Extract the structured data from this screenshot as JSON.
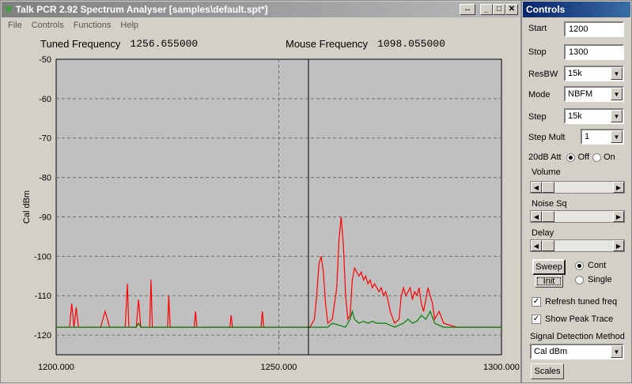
{
  "main_window": {
    "title": "Talk PCR 2.92 Spectrum Analyser [samples\\default.spt*]",
    "buttons": {
      "resize": "↔",
      "minimize": "_",
      "maximize": "□",
      "close": "✕"
    },
    "menu": [
      "File",
      "Controls",
      "Functions",
      "Help"
    ]
  },
  "readout": {
    "tuned_label": "Tuned Frequency",
    "tuned_value": "1256.655000",
    "mouse_label": "Mouse Frequency",
    "mouse_value": "1098.055000"
  },
  "chart_data": {
    "type": "line",
    "ylabel": "Cal dBm",
    "xlabel": "",
    "xlim": [
      1200,
      1300
    ],
    "ylim": [
      -120,
      -50
    ],
    "x_ticks": [
      "1200.000",
      "1250.000",
      "1300.000"
    ],
    "y_ticks": [
      "-50",
      "-60",
      "-70",
      "-80",
      "-90",
      "-100",
      "-110",
      "-120"
    ],
    "tuned_marker": 1256.655,
    "grid": "dashed",
    "series": [
      {
        "color": "#ff0000",
        "role": "peak",
        "points": [
          [
            1200,
            -118
          ],
          [
            1203,
            -118
          ],
          [
            1203.5,
            -112
          ],
          [
            1204,
            -118
          ],
          [
            1204.5,
            -113
          ],
          [
            1205,
            -118
          ],
          [
            1210,
            -118
          ],
          [
            1211,
            -114
          ],
          [
            1212,
            -118
          ],
          [
            1215.5,
            -118
          ],
          [
            1216,
            -107
          ],
          [
            1216.3,
            -118
          ],
          [
            1218,
            -118
          ],
          [
            1218.5,
            -111
          ],
          [
            1219,
            -118
          ],
          [
            1221,
            -118
          ],
          [
            1221.3,
            -106
          ],
          [
            1221.6,
            -118
          ],
          [
            1225,
            -118
          ],
          [
            1225.3,
            -110
          ],
          [
            1225.6,
            -118
          ],
          [
            1231,
            -118
          ],
          [
            1231.3,
            -114
          ],
          [
            1231.6,
            -118
          ],
          [
            1239,
            -118
          ],
          [
            1239.3,
            -115
          ],
          [
            1239.6,
            -118
          ],
          [
            1246,
            -118
          ],
          [
            1246.3,
            -114
          ],
          [
            1246.6,
            -118
          ],
          [
            1255,
            -118
          ],
          [
            1257,
            -118
          ],
          [
            1258,
            -116
          ],
          [
            1258.5,
            -110
          ],
          [
            1259,
            -102
          ],
          [
            1259.5,
            -100
          ],
          [
            1260,
            -104
          ],
          [
            1260.5,
            -112
          ],
          [
            1261,
            -117
          ],
          [
            1262,
            -116
          ],
          [
            1263,
            -108
          ],
          [
            1263.5,
            -96
          ],
          [
            1264,
            -90
          ],
          [
            1264.5,
            -97
          ],
          [
            1265,
            -110
          ],
          [
            1265.5,
            -116
          ],
          [
            1266,
            -115
          ],
          [
            1266.5,
            -106
          ],
          [
            1267,
            -103
          ],
          [
            1267.5,
            -104
          ],
          [
            1268,
            -105
          ],
          [
            1268.5,
            -104
          ],
          [
            1269,
            -106
          ],
          [
            1269.5,
            -105
          ],
          [
            1270,
            -107
          ],
          [
            1270.5,
            -106
          ],
          [
            1271,
            -108
          ],
          [
            1271.5,
            -107
          ],
          [
            1272,
            -108
          ],
          [
            1272.5,
            -109
          ],
          [
            1273,
            -108
          ],
          [
            1273.5,
            -110
          ],
          [
            1274,
            -109
          ],
          [
            1274.5,
            -111
          ],
          [
            1275,
            -114
          ],
          [
            1276,
            -117
          ],
          [
            1277,
            -116
          ],
          [
            1277.5,
            -110
          ],
          [
            1278,
            -108
          ],
          [
            1278.5,
            -110
          ],
          [
            1279,
            -109
          ],
          [
            1279.5,
            -108
          ],
          [
            1280,
            -111
          ],
          [
            1280.5,
            -109
          ],
          [
            1281,
            -110
          ],
          [
            1281.5,
            -108
          ],
          [
            1282,
            -112
          ],
          [
            1282.5,
            -114
          ],
          [
            1283,
            -111
          ],
          [
            1283.5,
            -108
          ],
          [
            1284,
            -110
          ],
          [
            1284.5,
            -112
          ],
          [
            1285,
            -116
          ],
          [
            1286,
            -114
          ],
          [
            1287,
            -117
          ],
          [
            1290,
            -118
          ],
          [
            1300,
            -118
          ]
        ]
      },
      {
        "color": "#008000",
        "role": "current",
        "points": [
          [
            1200,
            -118
          ],
          [
            1218,
            -118
          ],
          [
            1218.5,
            -117
          ],
          [
            1219,
            -118
          ],
          [
            1255,
            -118
          ],
          [
            1261,
            -118
          ],
          [
            1262,
            -117
          ],
          [
            1265,
            -118
          ],
          [
            1266,
            -116
          ],
          [
            1266.5,
            -114
          ],
          [
            1267,
            -116
          ],
          [
            1268,
            -117
          ],
          [
            1269,
            -116.5
          ],
          [
            1270,
            -117
          ],
          [
            1271,
            -116.5
          ],
          [
            1272,
            -117
          ],
          [
            1274,
            -117
          ],
          [
            1276,
            -118
          ],
          [
            1278,
            -117
          ],
          [
            1279,
            -116
          ],
          [
            1280,
            -117
          ],
          [
            1281,
            -116.5
          ],
          [
            1282,
            -115
          ],
          [
            1283,
            -116
          ],
          [
            1284,
            -114
          ],
          [
            1285,
            -117
          ],
          [
            1287,
            -118
          ],
          [
            1300,
            -118
          ]
        ]
      }
    ]
  },
  "controls": {
    "title": "Controls",
    "start_label": "Start",
    "start_value": "1200",
    "stop_label": "Stop",
    "stop_value": "1300",
    "resbw_label": "ResBW",
    "resbw_value": "15k",
    "mode_label": "Mode",
    "mode_value": "NBFM",
    "step_label": "Step",
    "step_value": "15k",
    "stepmult_label": "Step Mult",
    "stepmult_value": "1",
    "att_label": "20dB Att",
    "att_off": "Off",
    "att_on": "On",
    "att_selected": "Off",
    "volume_label": "Volume",
    "volume_level": 0.0,
    "noisesq_label": "Noise Sq",
    "noisesq_level": 0.0,
    "delay_label": "Delay",
    "delay_level": 0.0,
    "sweep_label": "Sweep",
    "init_label": "Init",
    "cont_label": "Cont",
    "single_label": "Single",
    "sweep_mode": "Cont",
    "refresh_label": "Refresh tuned freq",
    "refresh_checked": true,
    "peak_label": "Show Peak Trace",
    "peak_checked": true,
    "detect_label": "Signal Detection Method",
    "detect_value": "Cal dBm",
    "scales_label": "Scales"
  }
}
